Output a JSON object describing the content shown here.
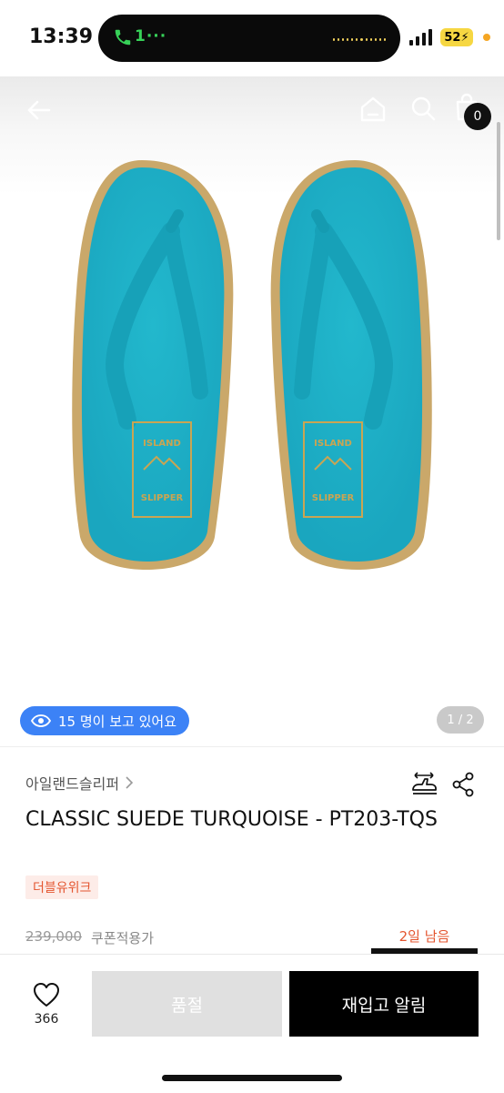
{
  "status_bar": {
    "time": "13:39",
    "call_text": "1···",
    "battery": "52",
    "colors": {
      "call": "#37d158",
      "battery": "#f6d742"
    }
  },
  "header": {
    "back_icon": "arrow-left-icon",
    "home_icon": "home-icon",
    "search_icon": "search-icon",
    "cart_icon": "shopping-bag-icon",
    "cart_count": "0"
  },
  "gallery": {
    "image_alt": "turquoise suede flip-flop sandals",
    "viewers_text": "15 명이 보고 있어요",
    "page_indicator": "1 / 2",
    "colors": {
      "viewer_pill": "#3c82f6",
      "sandal": "#1fb3c9"
    }
  },
  "product": {
    "brand": "아일랜드슬리퍼",
    "title": "CLASSIC SUEDE TURQUOISE - PT203-TQS",
    "tag": "더블유위크",
    "original_price": "239,000",
    "price_note": "쿠폰적용가",
    "days_left": "2일 남음",
    "compare_icon": "size-compare-icon",
    "share_icon": "share-icon",
    "accent_color": "#e4552f"
  },
  "bottom_bar": {
    "like_icon": "heart-icon",
    "like_count": "366",
    "soldout_label": "품절",
    "restock_label": "재입고 알림"
  }
}
